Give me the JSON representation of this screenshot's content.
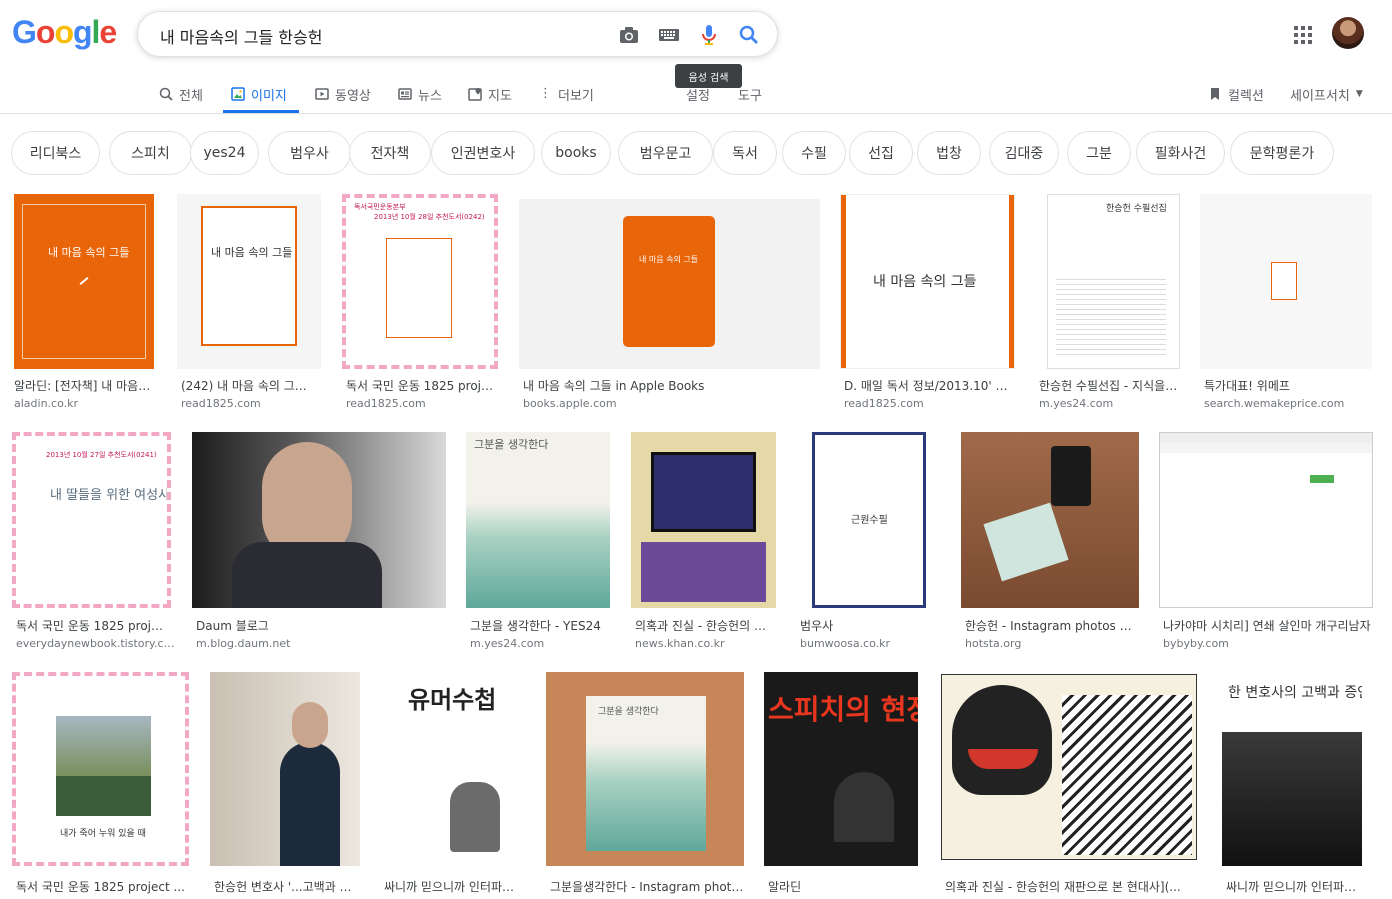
{
  "search": {
    "query": "내 마음속의 그들 한승헌"
  },
  "tooltip": "음성 검색",
  "tabs": [
    "전체",
    "이미지",
    "동영상",
    "뉴스",
    "지도",
    "더보기",
    "설정",
    "도구"
  ],
  "header_right": {
    "collections": "컬렉션",
    "safesearch": "세이프서치"
  },
  "chips": [
    "리디북스",
    "스피치",
    "yes24",
    "범우사",
    "전자책",
    "인권변호사",
    "books",
    "범우문고",
    "독서",
    "수필",
    "선집",
    "법창",
    "김대중",
    "그분",
    "필화사건",
    "문학평론가"
  ],
  "results": [
    {
      "caption": "알라딘: [전자책] 내 마음 속의 그들",
      "source": "aladin.co.kr",
      "thumb_text": "내 마음 속의 그들"
    },
    {
      "caption": "(242) 내 마음 속의 그들 - 한승헌",
      "source": "read1825.com",
      "thumb_text": "내 마음 속의 그들"
    },
    {
      "caption": "독서 국민 운동 1825 project",
      "source": "read1825.com",
      "thumb_text": "2013년 10월 28일 추천도서(0242)"
    },
    {
      "caption": "내 마음 속의 그들 in Apple Books",
      "source": "books.apple.com",
      "thumb_text": "내 마음 속의 그들"
    },
    {
      "caption": "D. 매일 독서 정보/2013.10' 추천도서",
      "source": "read1825.com",
      "thumb_text": "내 마음 속의 그들"
    },
    {
      "caption": "한승헌 수필선집 - 지식을만드는지식",
      "source": "m.yes24.com",
      "thumb_text": "한승헌 수필선집"
    },
    {
      "caption": "특가대표! 위메프",
      "source": "search.wemakeprice.com",
      "thumb_text": ""
    },
    {
      "caption": "독서 국민 운동 1825 project",
      "source": "everydaynewbook.tistory.com",
      "thumb_text": "내 딸들을 위한 여성사"
    },
    {
      "caption": "Daum 블로그",
      "source": "m.blog.daum.net",
      "thumb_text": ""
    },
    {
      "caption": "그분을 생각한다 - YES24",
      "source": "m.yes24.com",
      "thumb_text": "그분을 생각한다"
    },
    {
      "caption": "의혹과 진실 - 한승헌의 재판으로 본 현대사",
      "source": "news.khan.co.kr",
      "thumb_text": ""
    },
    {
      "caption": "범우사",
      "source": "bumwoosa.co.kr",
      "thumb_text": "근원수필"
    },
    {
      "caption": "한승헌 - Instagram photos and videos",
      "source": "hotsta.org",
      "thumb_text": ""
    },
    {
      "caption": "나카야마 시치리] 연쇄 살인마 개구리남자",
      "source": "bybyby.com",
      "thumb_text": ""
    },
    {
      "caption": "독서 국민 운동 1825 project ...",
      "source": "",
      "thumb_text": "내가 죽어 누워 있을 때"
    },
    {
      "caption": "한승헌 변호사 '...고백과 증언'",
      "source": "",
      "thumb_text": ""
    },
    {
      "caption": "싸니까 믿으니까 인터파크도서",
      "source": "",
      "thumb_text": "유머수첩"
    },
    {
      "caption": "그분을생각한다 - Instagram photos",
      "source": "",
      "thumb_text": "그분을 생각한다"
    },
    {
      "caption": "알라딘",
      "source": "",
      "thumb_text": "스피치의 현장"
    },
    {
      "caption": "의혹과 진실 - 한승헌의 재판으로 본 현대사](...",
      "source": "",
      "thumb_text": ""
    },
    {
      "caption": "싸니까 믿으니까 인터파크도서",
      "source": "",
      "thumb_text": "한 변호사의 고백과 증언"
    }
  ],
  "colors": {
    "accent": "#1a73e8",
    "orange": "#e8650a"
  }
}
